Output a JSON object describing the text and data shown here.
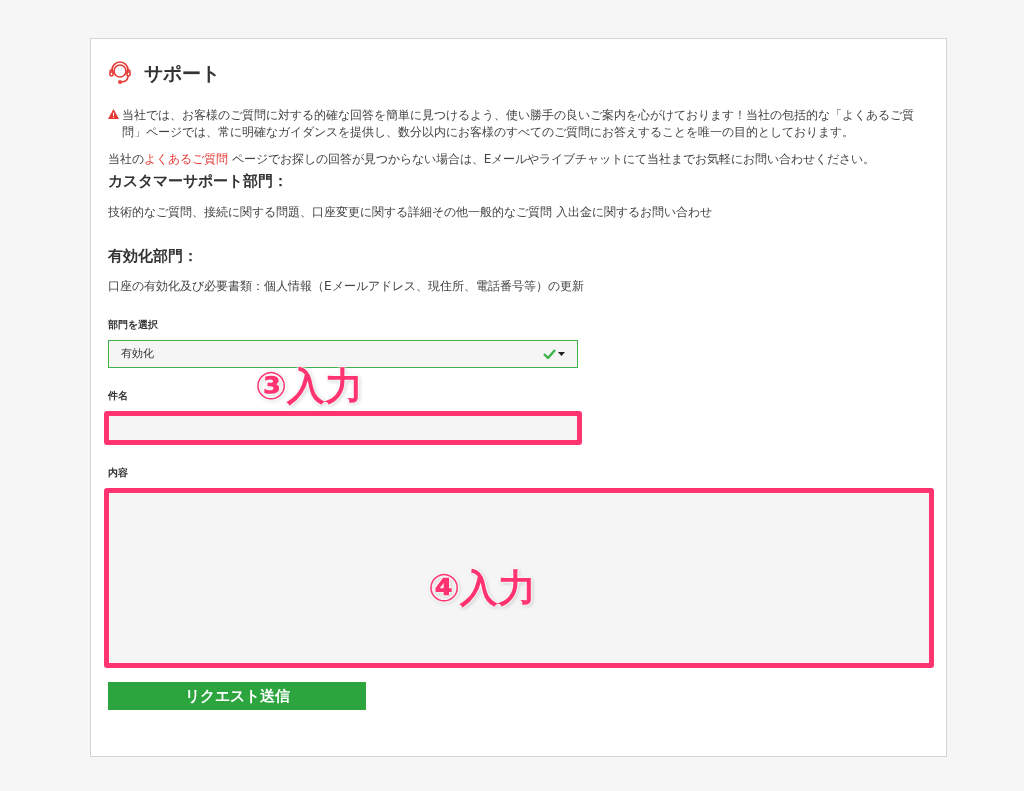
{
  "page": {
    "title": "サポート",
    "notice": "当社では、お客様のご質問に対する的確な回答を簡単に見つけるよう、使い勝手の良いご案内を心がけております！当社の包括的な「よくあるご質問」ページでは、常に明確なガイダンスを提供し、数分以内にお客様のすべてのご質問にお答えすることを唯一の目的としております。",
    "faq_line": {
      "before": "当社の",
      "link": "よくあるご質問",
      "after": " ページでお探しの回答が見つからない場合は、Eメールやライブチャットにて当社までお気軽にお問い合わせください。"
    },
    "sections": [
      {
        "heading": "カスタマーサポート部門：",
        "text": "技術的なご質問、接続に関する問題、口座変更に関する詳細その他一般的なご質問 入出金に関するお問い合わせ"
      },
      {
        "heading": "有効化部門：",
        "text": "口座の有効化及び必要書類：個人情報（Eメールアドレス、現住所、電話番号等）の更新"
      }
    ],
    "form": {
      "fields": [
        {
          "kind": "select",
          "label": "部門を選択",
          "value": "有効化",
          "valid": true
        },
        {
          "kind": "input",
          "label": "件名",
          "highlighted": true
        },
        {
          "kind": "textarea",
          "label": "内容",
          "highlighted": true
        }
      ],
      "submit": "リクエスト送信"
    }
  },
  "annotations": [
    {
      "text": "③入力"
    },
    {
      "text": "④入力"
    }
  ]
}
